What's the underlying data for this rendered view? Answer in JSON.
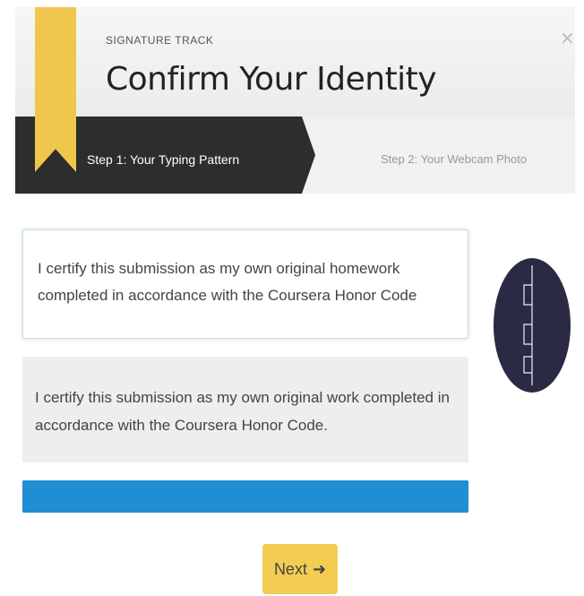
{
  "header": {
    "eyebrow": "SIGNATURE TRACK",
    "title": "Confirm Your Identity",
    "close_icon": "close-icon"
  },
  "steps": [
    {
      "label": "Step 1: Your Typing Pattern",
      "active": true
    },
    {
      "label": "Step 2: Your Webcam Photo",
      "active": false
    }
  ],
  "typing_input": {
    "value": "I certify this submission as my own original homework completed in accordance with the Coursera Honor Code"
  },
  "reference_text": "I certify this submission as my own original work completed in accordance with the Coursera Honor Code.",
  "progress": {
    "fraction": 1.0,
    "color": "#1f8ed3"
  },
  "next_button": {
    "label": "Next",
    "icon": "arrow-right-icon",
    "glyph": "➜"
  },
  "colors": {
    "ribbon": "#f0c64d",
    "active_step": "#2d2d2d",
    "button": "#f3cc52"
  }
}
